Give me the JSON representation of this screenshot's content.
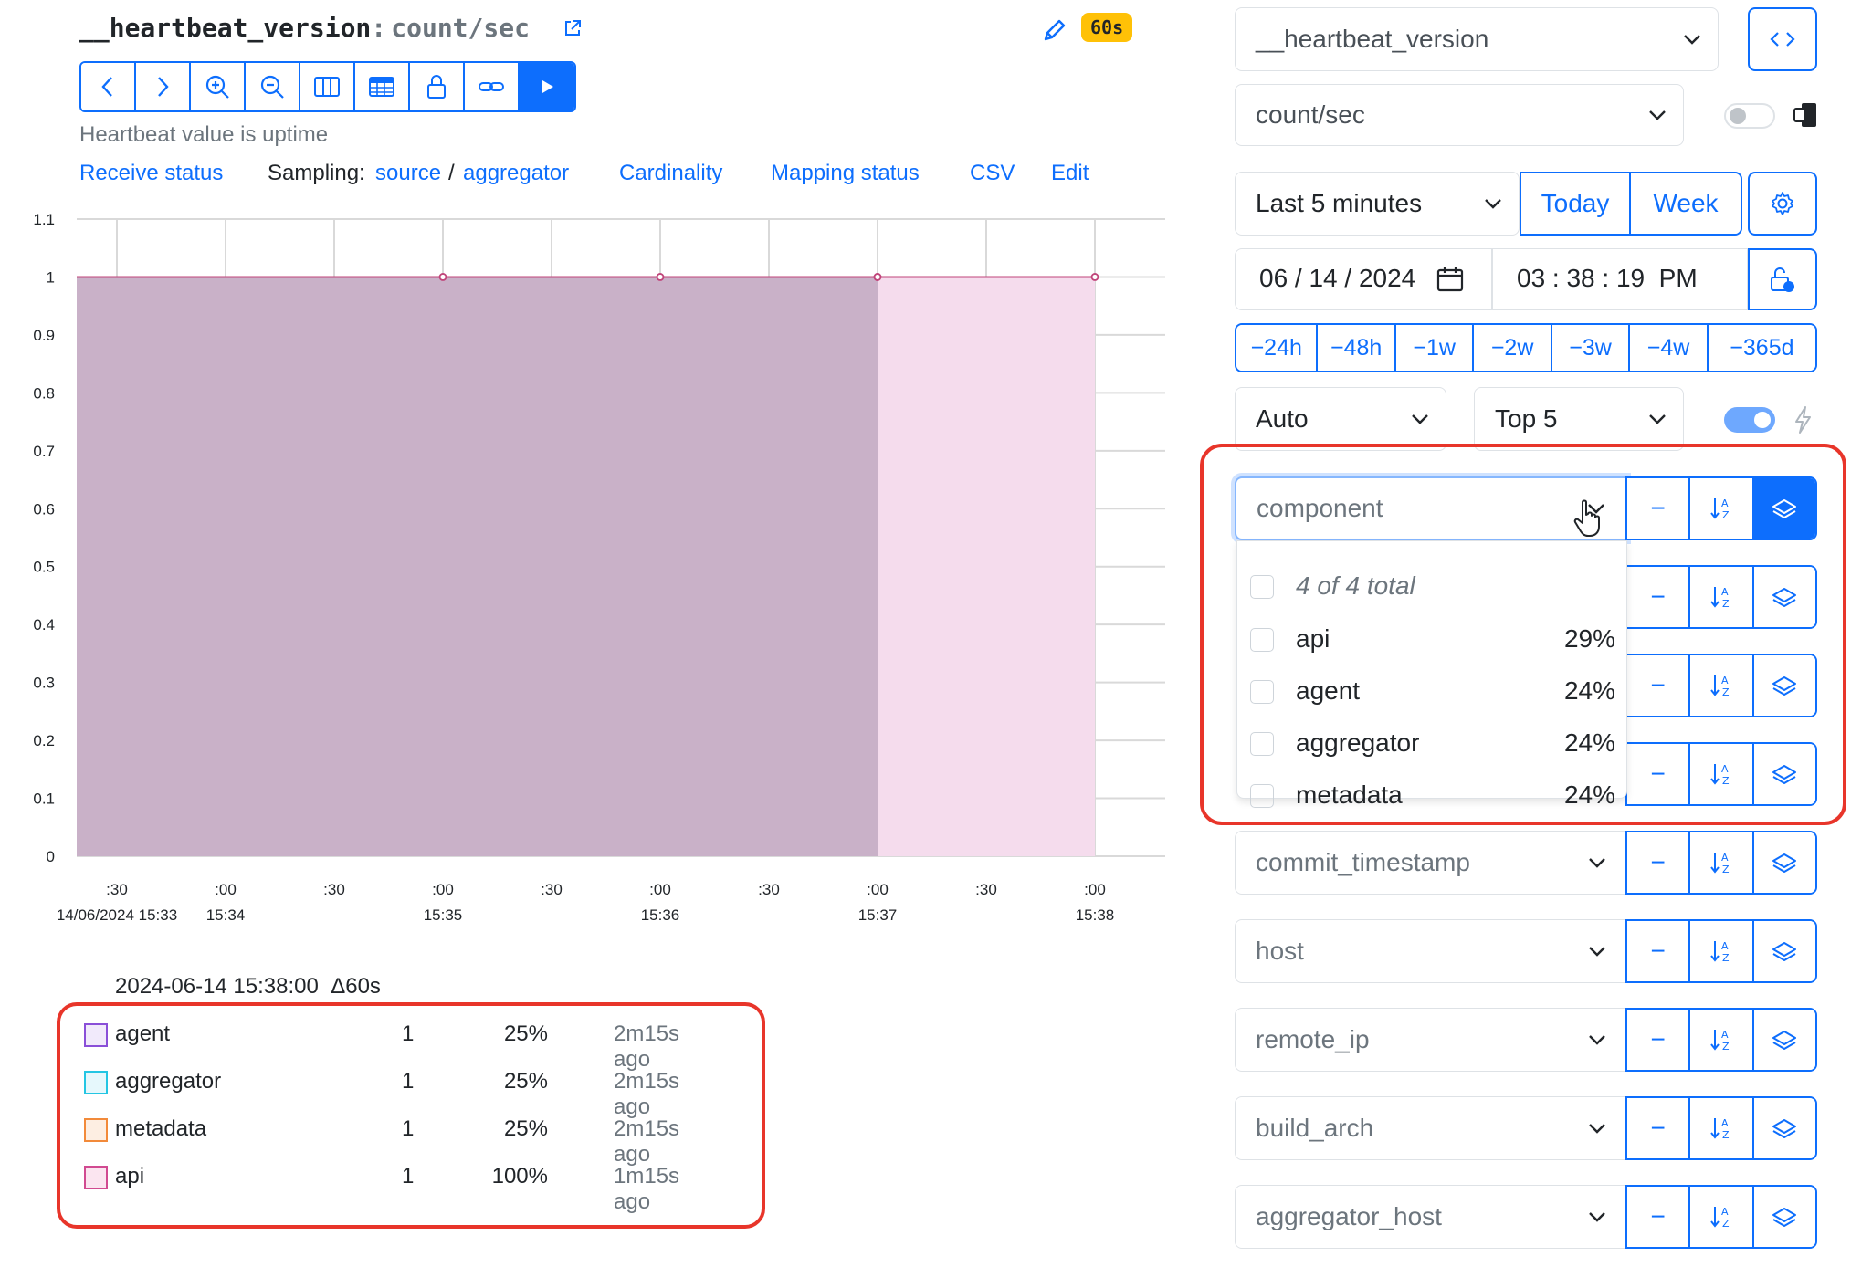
{
  "header": {
    "metric_name": "__heartbeat_version",
    "colon": ":",
    "metric_unit": "count/sec",
    "refresh_badge": "60s",
    "description": "Heartbeat value is uptime"
  },
  "toolbar": {
    "buttons": [
      "back",
      "forward",
      "zoom-in",
      "zoom-out",
      "columns",
      "table",
      "lock",
      "link",
      "play"
    ]
  },
  "links": {
    "receive_status": "Receive status",
    "sampling_label": "Sampling:",
    "sampling_source": "source",
    "sampling_sep": "/",
    "sampling_aggregator": "aggregator",
    "cardinality": "Cardinality",
    "mapping_status": "Mapping status",
    "csv": "CSV",
    "edit": "Edit"
  },
  "chart_data": {
    "type": "area",
    "yticks": [
      "0",
      "0.1",
      "0.2",
      "0.3",
      "0.4",
      "0.5",
      "0.6",
      "0.7",
      "0.8",
      "0.9",
      "1",
      "1.1"
    ],
    "ylim": [
      0,
      1.1
    ],
    "xticks_top": [
      ":30",
      ":00",
      ":30",
      ":00",
      ":30",
      ":00",
      ":30",
      ":00",
      ":30",
      ":00"
    ],
    "xticks_bottom": [
      "14/06/2024 15:33",
      "15:34",
      "",
      "15:35",
      "",
      "15:36",
      "",
      "15:37",
      "",
      "15:38"
    ],
    "grid": true,
    "series": [
      {
        "name": "api (stacked)",
        "color": "#c9b1c8",
        "x": [
          "15:33:00",
          "15:34:00",
          "15:35:00",
          "15:36:00"
        ],
        "y": [
          1,
          1,
          1,
          1
        ]
      },
      {
        "name": "api",
        "color": "#f5dced",
        "x": [
          "15:36:00",
          "15:37:00"
        ],
        "y": [
          1,
          1
        ]
      }
    ],
    "line_color": "#c0457a"
  },
  "legend": {
    "timestamp": "2024-06-14 15:38:00",
    "delta": "Δ60s",
    "rows": [
      {
        "name": "agent",
        "value": "1",
        "pct": "25%",
        "ago": "2m15s ago",
        "color": "#8a4fd8",
        "fill": "#f1eafb"
      },
      {
        "name": "aggregator",
        "value": "1",
        "pct": "25%",
        "ago": "2m15s ago",
        "color": "#24c6e3",
        "fill": "#e6f8fc"
      },
      {
        "name": "metadata",
        "value": "1",
        "pct": "25%",
        "ago": "2m15s ago",
        "color": "#f28a3a",
        "fill": "#fdeee2"
      },
      {
        "name": "api",
        "value": "1",
        "pct": "100%",
        "ago": "1m15s ago",
        "color": "#d14a91",
        "fill": "#fbe5f0"
      }
    ]
  },
  "controls": {
    "metric_select": "__heartbeat_version",
    "unit_select": "count/sec",
    "time_range": "Last 5 minutes",
    "today": "Today",
    "week": "Week",
    "date": "06 / 14 / 2024",
    "time": "03 : 38 : 19  PM",
    "shifts": [
      "−24h",
      "−48h",
      "−1w",
      "−2w",
      "−3w",
      "−4w",
      "−365d"
    ],
    "resolution": "Auto",
    "top_n": "Top 5",
    "minus": "−"
  },
  "tag_filter": {
    "open_tag": "component",
    "summary": "4 of 4 total",
    "items": [
      {
        "label": "api",
        "pct": "29%"
      },
      {
        "label": "agent",
        "pct": "24%"
      },
      {
        "label": "aggregator",
        "pct": "24%"
      },
      {
        "label": "metadata",
        "pct": "24%"
      }
    ],
    "tags": [
      "commit_timestamp",
      "host",
      "remote_ip",
      "build_arch",
      "aggregator_host"
    ]
  }
}
